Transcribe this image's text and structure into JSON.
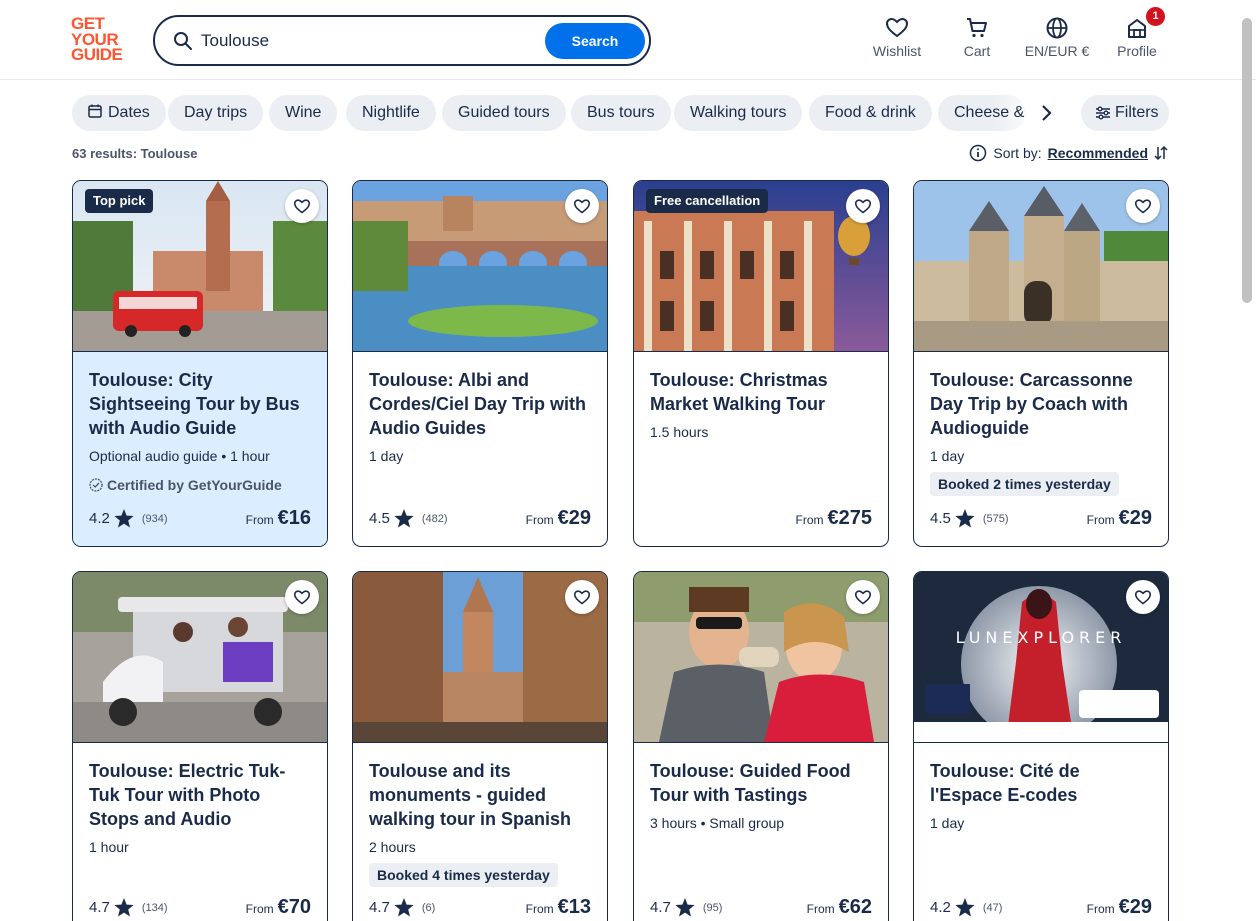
{
  "header": {
    "logo_lines": [
      "GET",
      "YOUR",
      "GUIDE"
    ],
    "search_value": "Toulouse",
    "search_button": "Search",
    "nav": [
      {
        "label": "Wishlist",
        "icon": "heart-icon"
      },
      {
        "label": "Cart",
        "icon": "cart-icon"
      },
      {
        "label": "EN/EUR €",
        "icon": "globe-icon"
      },
      {
        "label": "Profile",
        "icon": "profile-icon",
        "badge": "1"
      }
    ]
  },
  "chips": [
    "Dates",
    "Day trips",
    "Wine",
    "Nightlife",
    "Guided tours",
    "Bus tours",
    "Walking tours",
    "Food & drink",
    "Cheese &"
  ],
  "filters_label": "Filters",
  "results_text": "63 results: Toulouse",
  "sort": {
    "label": "Sort by:",
    "value": "Recommended"
  },
  "cards": [
    {
      "title": "Toulouse: City Sightseeing Tour by Bus with Audio Guide",
      "tag": "Top pick",
      "meta": "Optional audio guide • 1 hour",
      "certified": "Certified by GetYourGuide",
      "rating": "4.2",
      "reviews": "(934)",
      "from": "From",
      "price": "€16"
    },
    {
      "title": "Toulouse: Albi and Cordes/Ciel Day Trip with Audio Guides",
      "meta": "1 day",
      "rating": "4.5",
      "reviews": "(482)",
      "from": "From",
      "price": "€29"
    },
    {
      "title": "Toulouse: Christmas Market Walking Tour",
      "tag": "Free cancellation",
      "meta": "1.5 hours",
      "from": "From",
      "price": "€275"
    },
    {
      "title": "Toulouse: Carcassonne Day Trip by Coach with Audioguide",
      "meta": "1 day",
      "booked": "Booked 2 times yesterday",
      "rating": "4.5",
      "reviews": "(575)",
      "from": "From",
      "price": "€29"
    },
    {
      "title": "Toulouse: Electric Tuk-Tuk Tour with Photo Stops and Audio",
      "meta": "1 hour",
      "rating": "4.7",
      "reviews": "(134)",
      "from": "From",
      "price": "€70"
    },
    {
      "title": "Toulouse and its monuments - guided walking tour in Spanish",
      "meta": "2 hours",
      "booked": "Booked 4 times yesterday",
      "rating": "4.7",
      "reviews": "(6)",
      "from": "From",
      "price": "€13"
    },
    {
      "title": "Toulouse: Guided Food Tour with Tastings",
      "meta": "3 hours • Small group",
      "rating": "4.7",
      "reviews": "(95)",
      "from": "From",
      "price": "€62"
    },
    {
      "title": "Toulouse: Cité de l'Espace E-codes",
      "meta": "1 day",
      "image_text": "LUNEXPLORER",
      "rating": "4.2",
      "reviews": "(47)",
      "from": "From",
      "price": "€29"
    }
  ],
  "colors": {
    "brand": "#ff5533",
    "primary": "#0071eb",
    "navy": "#1a2b49",
    "highlight": "#dbeeff",
    "chip": "#ebeef2"
  }
}
